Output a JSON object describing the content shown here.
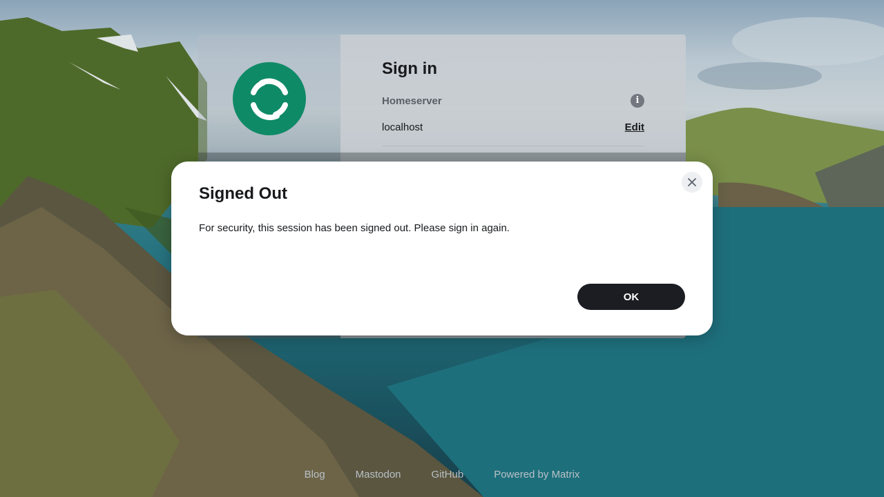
{
  "auth": {
    "title": "Sign in",
    "homeserver_label": "Homeserver",
    "server_name": "localhost",
    "edit_label": "Edit"
  },
  "dialog": {
    "title": "Signed Out",
    "message": "For security, this session has been signed out. Please sign in again.",
    "ok_label": "OK"
  },
  "footer": {
    "links": [
      "Blog",
      "Mastodon",
      "GitHub",
      "Powered by Matrix"
    ]
  },
  "icons": {
    "logo": "element-logo-icon",
    "info": "info-icon",
    "close": "close-icon"
  },
  "colors": {
    "brand": "#0f8a67",
    "primary_button": "#1b1d22"
  }
}
